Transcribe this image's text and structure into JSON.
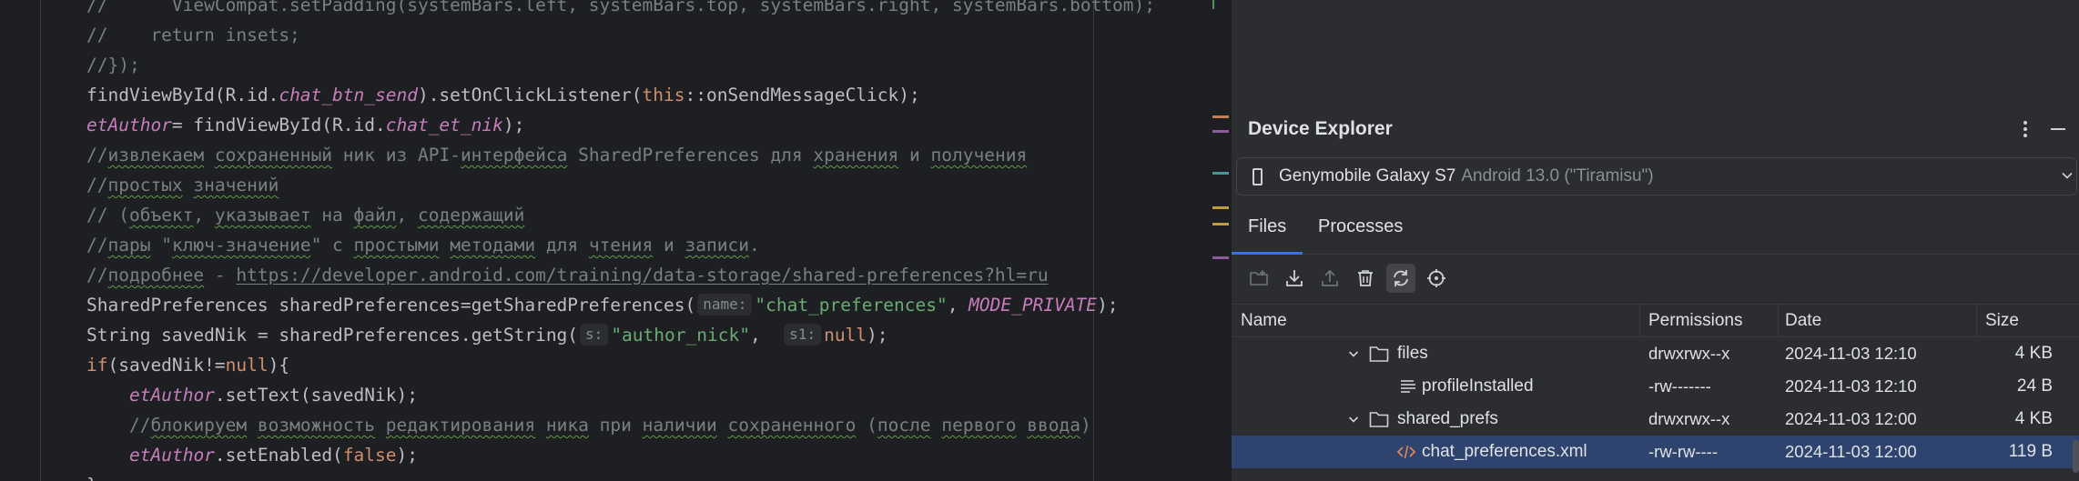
{
  "editor": {
    "lines": [
      {
        "parts": [
          {
            "t": "//      ViewCompat.setPadding(systemBars.left, systemBars.top, systemBars.right, systemBars.bottom);",
            "c": "t-com"
          }
        ]
      },
      {
        "parts": [
          {
            "t": "//    return insets;",
            "c": "t-com"
          }
        ]
      },
      {
        "parts": [
          {
            "t": "//});",
            "c": "t-com"
          }
        ]
      },
      {
        "parts": [
          {
            "t": "findViewById(R.id."
          },
          {
            "t": "chat_btn_send",
            "c": "t-field"
          },
          {
            "t": ").setOnClickListener("
          },
          {
            "t": "this",
            "c": "t-kw"
          },
          {
            "t": "::onSendMessageClick);"
          }
        ]
      },
      {
        "parts": [
          {
            "t": "etAuthor",
            "c": "t-field"
          },
          {
            "t": "= findViewById(R.id."
          },
          {
            "t": "chat_et_nik",
            "c": "t-field"
          },
          {
            "t": ");"
          }
        ]
      },
      {
        "parts": [
          {
            "t": "//",
            "c": "t-com"
          },
          {
            "t": "извлекаем",
            "c": "t-com t-wavy"
          },
          {
            "t": " ",
            "c": "t-com"
          },
          {
            "t": "сохраненный",
            "c": "t-com t-wavy"
          },
          {
            "t": " ник из API-",
            "c": "t-com"
          },
          {
            "t": "интерфейса",
            "c": "t-com t-wavy"
          },
          {
            "t": " SharedPreferences для ",
            "c": "t-com"
          },
          {
            "t": "хранения",
            "c": "t-com t-wavy"
          },
          {
            "t": " и ",
            "c": "t-com"
          },
          {
            "t": "получения",
            "c": "t-com t-wavy"
          }
        ]
      },
      {
        "parts": [
          {
            "t": "//",
            "c": "t-com"
          },
          {
            "t": "простых",
            "c": "t-com t-wavy"
          },
          {
            "t": " ",
            "c": "t-com"
          },
          {
            "t": "значений",
            "c": "t-com t-wavy"
          }
        ]
      },
      {
        "parts": [
          {
            "t": "// (",
            "c": "t-com"
          },
          {
            "t": "объект",
            "c": "t-com t-wavy"
          },
          {
            "t": ", ",
            "c": "t-com"
          },
          {
            "t": "указывает",
            "c": "t-com t-wavy"
          },
          {
            "t": " на ",
            "c": "t-com"
          },
          {
            "t": "файл",
            "c": "t-com t-wavy"
          },
          {
            "t": ", ",
            "c": "t-com"
          },
          {
            "t": "содержащий",
            "c": "t-com t-wavy"
          }
        ]
      },
      {
        "parts": [
          {
            "t": "//",
            "c": "t-com"
          },
          {
            "t": "пары",
            "c": "t-com t-wavy"
          },
          {
            "t": " \"",
            "c": "t-com"
          },
          {
            "t": "ключ-значение",
            "c": "t-com t-wavy"
          },
          {
            "t": "\" с ",
            "c": "t-com"
          },
          {
            "t": "простыми",
            "c": "t-com t-wavy"
          },
          {
            "t": " ",
            "c": "t-com"
          },
          {
            "t": "методами",
            "c": "t-com t-wavy"
          },
          {
            "t": " для ",
            "c": "t-com"
          },
          {
            "t": "чтения",
            "c": "t-com t-wavy"
          },
          {
            "t": " и ",
            "c": "t-com"
          },
          {
            "t": "записи",
            "c": "t-com t-wavy"
          },
          {
            "t": ".",
            "c": "t-com"
          }
        ]
      },
      {
        "parts": [
          {
            "t": "//",
            "c": "t-com"
          },
          {
            "t": "подробнее",
            "c": "t-com t-wavy"
          },
          {
            "t": " - ",
            "c": "t-com"
          },
          {
            "t": "https://developer.android.com/training/data-storage/shared-preferences?hl=ru",
            "c": "t-com t-link"
          }
        ]
      },
      {
        "parts": [
          {
            "t": "SharedPreferences sharedPreferences=getSharedPreferences("
          },
          {
            "hint": "name:"
          },
          {
            "t": "\"chat_preferences\"",
            "c": "t-str"
          },
          {
            "t": ", "
          },
          {
            "t": "MODE_PRIVATE",
            "c": "t-const"
          },
          {
            "t": ");"
          }
        ]
      },
      {
        "parts": [
          {
            "t": "String savedNik = sharedPreferences.getString("
          },
          {
            "hint": "s:"
          },
          {
            "t": "\"author_nick\"",
            "c": "t-str"
          },
          {
            "t": ",  "
          },
          {
            "hint": "s1:"
          },
          {
            "t": "null",
            "c": "t-kw"
          },
          {
            "t": ");"
          }
        ]
      },
      {
        "parts": [
          {
            "t": "if",
            "c": "t-kw"
          },
          {
            "t": "(savedNik!="
          },
          {
            "t": "null",
            "c": "t-kw"
          },
          {
            "t": "){"
          }
        ]
      },
      {
        "indent": 1,
        "parts": [
          {
            "t": "etAuthor",
            "c": "t-field"
          },
          {
            "t": ".setText(savedNik);"
          }
        ]
      },
      {
        "indent": 1,
        "parts": [
          {
            "t": "//",
            "c": "t-com"
          },
          {
            "t": "блокируем",
            "c": "t-com t-wavy"
          },
          {
            "t": " ",
            "c": "t-com"
          },
          {
            "t": "возможность",
            "c": "t-com t-wavy"
          },
          {
            "t": " ",
            "c": "t-com"
          },
          {
            "t": "редактирования",
            "c": "t-com t-wavy"
          },
          {
            "t": " ",
            "c": "t-com"
          },
          {
            "t": "ника",
            "c": "t-com t-wavy"
          },
          {
            "t": " при ",
            "c": "t-com"
          },
          {
            "t": "наличии",
            "c": "t-com t-wavy"
          },
          {
            "t": " ",
            "c": "t-com"
          },
          {
            "t": "сохраненного",
            "c": "t-com t-wavy"
          },
          {
            "t": " (",
            "c": "t-com"
          },
          {
            "t": "после",
            "c": "t-com t-wavy"
          },
          {
            "t": " ",
            "c": "t-com"
          },
          {
            "t": "первого",
            "c": "t-com t-wavy"
          },
          {
            "t": " ",
            "c": "t-com"
          },
          {
            "t": "ввода",
            "c": "t-com t-wavy"
          },
          {
            "t": ")",
            "c": "t-com"
          }
        ]
      },
      {
        "indent": 1,
        "parts": [
          {
            "t": "etAuthor",
            "c": "t-field"
          },
          {
            "t": ".setEnabled("
          },
          {
            "t": "false",
            "c": "t-kw"
          },
          {
            "t": ");"
          }
        ]
      },
      {
        "parts": [
          {
            "t": "}"
          }
        ]
      }
    ]
  },
  "device_explorer": {
    "title": "Device Explorer",
    "options_icon": "more-vertical-icon",
    "minimize_icon": "minimize-icon",
    "device": {
      "name": "Genymobile Galaxy S7",
      "os": "Android 13.0 (\"Tiramisu\")"
    },
    "tabs": {
      "files": "Files",
      "processes": "Processes",
      "active": "Files"
    },
    "toolbar_icons": [
      "new-folder-icon",
      "download-icon",
      "upload-icon",
      "delete-icon",
      "sync-icon",
      "target-icon"
    ],
    "columns": {
      "name": "Name",
      "permissions": "Permissions",
      "date": "Date",
      "size": "Size"
    },
    "rows": [
      {
        "name": "files",
        "type": "folder",
        "expanded": true,
        "permissions": "drwxrwx--x",
        "date": "2024-11-03 12:10",
        "size": "4 KB"
      },
      {
        "name": "profileInstalled",
        "type": "file",
        "permissions": "-rw-------",
        "date": "2024-11-03 12:10",
        "size": "24 B"
      },
      {
        "name": "shared_prefs",
        "type": "folder",
        "expanded": true,
        "permissions": "drwxrwx--x",
        "date": "2024-11-03 12:00",
        "size": "4 KB"
      },
      {
        "name": "chat_preferences.xml",
        "type": "xml",
        "selected": true,
        "permissions": "-rw-rw----",
        "date": "2024-11-03 12:00",
        "size": "119 B"
      }
    ],
    "colors": {
      "accent": "#3574f0",
      "selection": "#2e436e",
      "panel_bg": "#2b2d30",
      "editor_bg": "#1e1f22"
    }
  }
}
